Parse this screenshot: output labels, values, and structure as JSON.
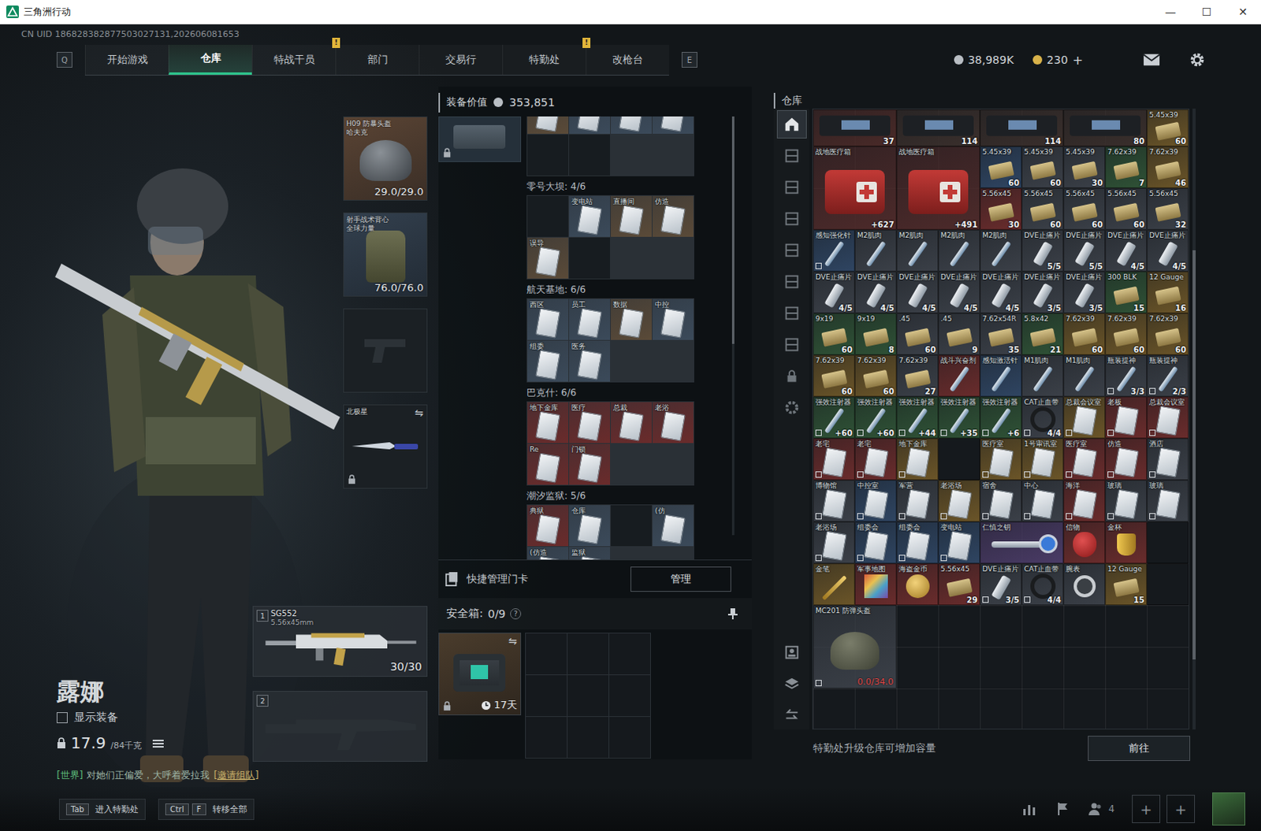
{
  "window": {
    "title": "三角洲行动",
    "controls": [
      "—",
      "☐",
      "✕"
    ]
  },
  "uid": "CN UID 186828382877503027131,202606081653",
  "nav": {
    "left_key": "Q",
    "right_key": "E",
    "tabs": [
      {
        "label": "开始游戏",
        "selected": false
      },
      {
        "label": "仓库",
        "selected": true
      },
      {
        "label": "特战干员",
        "selected": false,
        "badge": "!"
      },
      {
        "label": "部门",
        "selected": false
      },
      {
        "label": "交易行",
        "selected": false
      },
      {
        "label": "特勤处",
        "selected": false,
        "badge": "!"
      },
      {
        "label": "改枪台",
        "selected": false
      }
    ],
    "wallet": [
      {
        "value": "38,989K",
        "color": "#b9bec4"
      },
      {
        "value": "230",
        "plus": "+",
        "color": "#d8b24a"
      }
    ]
  },
  "operator": {
    "name": "露娜",
    "show_gear": {
      "label": "显示装备",
      "checked": false
    },
    "weight": "17.9",
    "capacity": "/84千克",
    "chat": {
      "channel": "[世界]",
      "text": "对她们正偏爱，大呼着爱拉我",
      "link": "[邀请组队]"
    }
  },
  "equipment": {
    "helmet": {
      "name": "H09 防暴头盔",
      "sub": "哈夫克",
      "durability": "29.0/29.0"
    },
    "armor": {
      "name": "射手战术背心",
      "sub": "全球力量",
      "durability": "76.0/76.0"
    },
    "pistol": {
      "empty": true
    },
    "melee": {
      "name": "北极星",
      "swap": "⇋",
      "locked": true
    }
  },
  "weapons": [
    {
      "slot": "1",
      "name": "SG552",
      "caliber": "5.56x45mm",
      "ammo": "30/30",
      "empty": false
    },
    {
      "slot": "2",
      "empty": true
    }
  ],
  "loadout": {
    "value_label": "装备价值",
    "value": "353,851",
    "keycase_locked": true,
    "sections": [
      {
        "cards": [
          {
            "kind": "card",
            "color": "#5a4a38"
          },
          {
            "kind": "card",
            "color": "#3b4a5a"
          },
          {
            "kind": "card",
            "color": "#3b4a5a"
          },
          {
            "kind": "card",
            "color": "#3b4a5a"
          },
          {
            "kind": "empty"
          },
          {
            "kind": "empty"
          }
        ]
      },
      {
        "title": "零号大坝: 4/6",
        "cards": [
          {
            "kind": "empty"
          },
          {
            "kind": "card",
            "label": "变电站",
            "color": "#3b4a5a"
          },
          {
            "kind": "card",
            "label": "直播间",
            "color": "#5a4a38"
          },
          {
            "kind": "card",
            "label": "仿造",
            "color": "#5a4a38"
          },
          {
            "kind": "card",
            "label": "误导",
            "color": "#5a4a38"
          },
          {
            "kind": "empty"
          }
        ]
      },
      {
        "title": "航天基地: 6/6",
        "cards": [
          {
            "kind": "card",
            "label": "西区",
            "color": "#3b4a5a"
          },
          {
            "kind": "card",
            "label": "员工",
            "color": "#3b4a5a"
          },
          {
            "kind": "card",
            "label": "数据",
            "color": "#5a4a38"
          },
          {
            "kind": "card",
            "label": "中控",
            "color": "#3b4a5a"
          },
          {
            "kind": "card",
            "label": "组委",
            "color": "#3b4a5a"
          },
          {
            "kind": "card",
            "label": "医务",
            "color": "#3b4a5a"
          }
        ]
      },
      {
        "title": "巴克什: 6/6",
        "cards": [
          {
            "kind": "card",
            "label": "地下金库",
            "color": "#6a2b2b"
          },
          {
            "kind": "card",
            "label": "医疗",
            "color": "#6a2b2b"
          },
          {
            "kind": "card",
            "label": "总裁",
            "color": "#6a2b2b"
          },
          {
            "kind": "card",
            "label": "老浴",
            "color": "#6a2b2b"
          },
          {
            "kind": "card",
            "label": "Re",
            "color": "#6a2b2b"
          },
          {
            "kind": "card",
            "label": "门锁",
            "color": "#6a2b2b"
          }
        ]
      },
      {
        "title": "潮汐监狱: 5/6",
        "cards": [
          {
            "kind": "card",
            "label": "典狱",
            "color": "#6a2b2b"
          },
          {
            "kind": "card",
            "label": "仓库",
            "color": "#3b4a5a"
          },
          {
            "kind": "empty"
          },
          {
            "kind": "card",
            "label": "(仿",
            "color": "#3b4a5a"
          },
          {
            "kind": "card",
            "label": "(仿造",
            "color": "#3b4a5a"
          },
          {
            "kind": "card",
            "label": "监狱",
            "color": "#3b4a5a"
          }
        ]
      }
    ],
    "quick_label": "快捷管理门卡",
    "manage": "管理",
    "safe": {
      "label": "安全箱:",
      "count": "0/9",
      "help": "?",
      "days": "17天",
      "swap": "⇋",
      "locked": true
    }
  },
  "warehouse": {
    "title": "仓库",
    "side_tabs": [
      {
        "kind": "home",
        "selected": true
      },
      {
        "kind": "shelf",
        "selected": false
      },
      {
        "kind": "shelf",
        "selected": false
      },
      {
        "kind": "shelf",
        "selected": false
      },
      {
        "kind": "shelf",
        "selected": false
      },
      {
        "kind": "shelf",
        "selected": false
      },
      {
        "kind": "shelf",
        "selected": false
      },
      {
        "kind": "shelf",
        "selected": false
      },
      {
        "kind": "lock",
        "selected": false
      },
      {
        "kind": "gear",
        "selected": false
      }
    ],
    "tools": [
      {
        "kind": "person"
      },
      {
        "kind": "layers"
      },
      {
        "kind": "transfer"
      }
    ],
    "items": [
      {
        "kind": "case",
        "count": "37",
        "color": "#4a2a28",
        "bound": false
      },
      {
        "kind": "case",
        "count": "114",
        "color": "#3a2f2c",
        "bound": false
      },
      {
        "kind": "case",
        "count": "114",
        "color": "#3a2f2c",
        "bound": false
      },
      {
        "kind": "case",
        "count": "80",
        "color": "#3a2f2c",
        "bound": false
      },
      {
        "kind": "ammo",
        "name": "5.45x39",
        "count": "60",
        "color": "#6b5528",
        "bound": false
      },
      {
        "kind": "medkit",
        "name": "战地医疗箱",
        "count": "+627",
        "color": "#4d2a2a",
        "bound": false
      },
      {
        "kind": "medkit",
        "name": "战地医疗箱",
        "count": "+491",
        "color": "#4d2a2a",
        "bound": false
      },
      {
        "kind": "ammo",
        "name": "5.45x39",
        "count": "60",
        "color": "#2f4562",
        "bound": false
      },
      {
        "kind": "ammo",
        "name": "5.45x39",
        "count": "60",
        "color": "#3b4048",
        "bound": false
      },
      {
        "kind": "ammo",
        "name": "5.45x39",
        "count": "30",
        "color": "#3b4048",
        "bound": false
      },
      {
        "kind": "ammo",
        "name": "7.62x39",
        "count": "7",
        "color": "#2f5236",
        "bound": false
      },
      {
        "kind": "ammo",
        "name": "7.62x39",
        "count": "46",
        "color": "#6b5528",
        "bound": false
      },
      {
        "kind": "ammo",
        "name": "5.56x45",
        "count": "30",
        "color": "#6a2c2c",
        "bound": false
      },
      {
        "kind": "ammo",
        "name": "5.56x45",
        "count": "60",
        "color": "#3b4048",
        "bound": false
      },
      {
        "kind": "ammo",
        "name": "5.56x45",
        "count": "60",
        "color": "#3b4048",
        "bound": false
      },
      {
        "kind": "ammo",
        "name": "5.56x45",
        "count": "60",
        "color": "#3b4048",
        "bound": false
      },
      {
        "kind": "ammo",
        "name": "5.56x45",
        "count": "32",
        "color": "#3b4048",
        "bound": false
      },
      {
        "kind": "syringe",
        "name": "感知强化针",
        "color": "#2f4562",
        "bound": true
      },
      {
        "kind": "syringe",
        "name": "M2肌肉",
        "color": "#3b4048",
        "bound": false
      },
      {
        "kind": "syringe",
        "name": "M2肌肉",
        "color": "#3b4048",
        "bound": false
      },
      {
        "kind": "syringe",
        "name": "M2肌肉",
        "color": "#3b4048",
        "bound": false
      },
      {
        "kind": "syringe",
        "name": "M2肌肉",
        "color": "#3b4048",
        "bound": false
      },
      {
        "kind": "pills",
        "name": "DVE止痛片",
        "count": "5/5",
        "color": "#3b4048",
        "bound": false
      },
      {
        "kind": "pills",
        "name": "DVE止痛片",
        "count": "5/5",
        "color": "#3b4048",
        "bound": false
      },
      {
        "kind": "pills",
        "name": "DVE止痛片",
        "count": "4/5",
        "color": "#3b4048",
        "bound": false
      },
      {
        "kind": "pills",
        "name": "DVE止痛片",
        "count": "4/5",
        "color": "#3b4048",
        "bound": false
      },
      {
        "kind": "pills",
        "name": "DVE止痛片",
        "count": "4/5",
        "color": "#3b4048",
        "bound": false
      },
      {
        "kind": "pills",
        "name": "DVE止痛片",
        "count": "4/5",
        "color": "#3b4048",
        "bound": false
      },
      {
        "kind": "pills",
        "name": "DVE止痛片",
        "count": "4/5",
        "color": "#3b4048",
        "bound": false
      },
      {
        "kind": "pills",
        "name": "DVE止痛片",
        "count": "4/5",
        "color": "#3b4048",
        "bound": false
      },
      {
        "kind": "pills",
        "name": "DVE止痛片",
        "count": "4/5",
        "color": "#3b4048",
        "bound": false
      },
      {
        "kind": "pills",
        "name": "DVE止痛片",
        "count": "3/5",
        "color": "#3b4048",
        "bound": false
      },
      {
        "kind": "pills",
        "name": "DVE止痛片",
        "count": "3/5",
        "color": "#3b4048",
        "bound": false
      },
      {
        "kind": "ammo",
        "name": "300 BLK",
        "count": "15",
        "color": "#2f5236",
        "bound": false
      },
      {
        "kind": "ammo",
        "name": "12 Gauge",
        "count": "16",
        "color": "#6b5528",
        "bound": false
      },
      {
        "kind": "ammo",
        "name": "9x19",
        "count": "60",
        "color": "#2f5236",
        "bound": false
      },
      {
        "kind": "ammo",
        "name": "9x19",
        "count": "8",
        "color": "#2f5236",
        "bound": false
      },
      {
        "kind": "ammo",
        "name": ".45",
        "count": "60",
        "color": "#3b4048",
        "bound": false
      },
      {
        "kind": "ammo",
        "name": ".45",
        "count": "9",
        "color": "#3b4048",
        "bound": false
      },
      {
        "kind": "ammo",
        "name": "7.62x54R",
        "count": "35",
        "color": "#3b4048",
        "bound": false
      },
      {
        "kind": "ammo",
        "name": "5.8x42",
        "count": "21",
        "color": "#2f5236",
        "bound": false
      },
      {
        "kind": "ammo",
        "name": "7.62x39",
        "count": "60",
        "color": "#6b5528",
        "bound": false
      },
      {
        "kind": "ammo",
        "name": "7.62x39",
        "count": "60",
        "color": "#6b5528",
        "bound": false
      },
      {
        "kind": "ammo",
        "name": "7.62x39",
        "count": "60",
        "color": "#6b5528",
        "bound": false
      },
      {
        "kind": "ammo",
        "name": "7.62x39",
        "count": "60",
        "color": "#6b5528",
        "bound": false
      },
      {
        "kind": "ammo",
        "name": "7.62x39",
        "count": "60",
        "color": "#6b5528",
        "bound": false
      },
      {
        "kind": "ammo",
        "name": "7.62x39",
        "count": "27",
        "color": "#3b4048",
        "bound": false
      },
      {
        "kind": "syringe",
        "name": "战斗兴奋剂",
        "color": "#6a2c2c",
        "bound": false
      },
      {
        "kind": "syringe",
        "name": "感知激活针",
        "color": "#2f4562",
        "bound": false
      },
      {
        "kind": "syringe",
        "name": "M1肌肉",
        "color": "#3b4048",
        "bound": false
      },
      {
        "kind": "syringe",
        "name": "M1肌肉",
        "color": "#3b4048",
        "bound": false
      },
      {
        "kind": "syringe",
        "name": "瓶装提神",
        "count": "3/3",
        "color": "#3b4048",
        "bound": true
      },
      {
        "kind": "syringe",
        "name": "瓶装提神",
        "count": "2/3",
        "color": "#3b4048",
        "bound": true
      },
      {
        "kind": "syringe",
        "name": "强效注射器",
        "count": "+60",
        "color": "#2f5236",
        "bound": true
      },
      {
        "kind": "syringe",
        "name": "强效注射器",
        "count": "+60",
        "color": "#2f5236",
        "bound": true
      },
      {
        "kind": "syringe",
        "name": "强效注射器",
        "count": "+44",
        "color": "#2f5236",
        "bound": true
      },
      {
        "kind": "syringe",
        "name": "强效注射器",
        "count": "+35",
        "color": "#2f5236",
        "bound": true
      },
      {
        "kind": "syringe",
        "name": "强效注射器",
        "count": "+6",
        "color": "#2f5236",
        "bound": true
      },
      {
        "kind": "band",
        "name": "CAT止血带",
        "count": "4/4",
        "color": "#3b4048",
        "bound": true
      },
      {
        "kind": "card",
        "name": "总裁会议室",
        "color": "#6b5528",
        "bound": true
      },
      {
        "kind": "card",
        "name": "老板",
        "color": "#6a2c2c",
        "bound": true
      },
      {
        "kind": "card",
        "name": "总裁会议室",
        "color": "#6a2c2c",
        "bound": true
      },
      {
        "kind": "card",
        "name": "老宅",
        "color": "#6a2c2c",
        "bound": true
      },
      {
        "kind": "card",
        "name": "老宅",
        "color": "#6a2c2c",
        "bound": true
      },
      {
        "kind": "card",
        "name": "地下金库",
        "color": "#6b5528",
        "bound": true
      },
      {
        "kind": "empty"
      },
      {
        "kind": "card",
        "name": "医疗室",
        "color": "#6b5528",
        "bound": true
      },
      {
        "kind": "card",
        "name": "1号审讯室",
        "color": "#6b5528",
        "bound": true
      },
      {
        "kind": "card",
        "name": "医疗室",
        "color": "#6a2c2c",
        "bound": true
      },
      {
        "kind": "card",
        "name": "仿造",
        "color": "#6a2c2c",
        "bound": true
      },
      {
        "kind": "card",
        "name": "酒店",
        "color": "#3b4048",
        "bound": true
      },
      {
        "kind": "card",
        "name": "博物馆",
        "color": "#3b4048",
        "bound": true
      },
      {
        "kind": "card",
        "name": "中控室",
        "color": "#2f4562",
        "bound": true
      },
      {
        "kind": "card",
        "name": "军营",
        "color": "#3b4048",
        "bound": true
      },
      {
        "kind": "card",
        "name": "老浴场",
        "color": "#6b5528",
        "bound": true
      },
      {
        "kind": "card",
        "name": "宿舍",
        "color": "#3b4048",
        "bound": true
      },
      {
        "kind": "card",
        "name": "中心",
        "color": "#3b4048",
        "bound": true
      },
      {
        "kind": "card",
        "name": "海洋",
        "color": "#6a2c2c",
        "bound": true
      },
      {
        "kind": "card",
        "name": "玻璃",
        "color": "#3b4048",
        "bound": true
      },
      {
        "kind": "card",
        "name": "玻璃",
        "color": "#3b4048",
        "bound": true
      },
      {
        "kind": "card",
        "name": "老浴场",
        "color": "#3b4048",
        "bound": true
      },
      {
        "kind": "card",
        "name": "组委会",
        "color": "#2f4562",
        "bound": true
      },
      {
        "kind": "card",
        "name": "组委会",
        "color": "#2f4562",
        "bound": true
      },
      {
        "kind": "card",
        "name": "变电站",
        "color": "#2f4562",
        "bound": true
      },
      {
        "kind": "key",
        "name": "仁慎之钥",
        "color": "#4a3b66",
        "bound": false
      },
      {
        "kind": "mask",
        "name": "信物",
        "color": "#6a2c2c",
        "bound": false
      },
      {
        "kind": "cup",
        "name": "金杯",
        "color": "#6a2c2c",
        "bound": false
      },
      {
        "kind": "empty"
      },
      {
        "kind": "pen",
        "name": "金笔",
        "color": "#6b5528",
        "bound": false
      },
      {
        "kind": "map",
        "name": "军事地图",
        "color": "#6a2c2c",
        "bound": false
      },
      {
        "kind": "coin",
        "name": "海盗金币",
        "color": "#6a2c2c",
        "bound": false
      },
      {
        "kind": "ammo",
        "name": "5.56x45",
        "count": "29",
        "color": "#6a2c2c",
        "bound": false
      },
      {
        "kind": "pills",
        "name": "DVE止痛片",
        "count": "3/5",
        "color": "#3b4048",
        "bound": true
      },
      {
        "kind": "band",
        "name": "CAT止血带",
        "count": "4/4",
        "color": "#3b4048",
        "bound": true
      },
      {
        "kind": "watch",
        "name": "腕表",
        "color": "#3b4048",
        "bound": false
      },
      {
        "kind": "ammo",
        "name": "12 Gauge",
        "count": "15",
        "color": "#6b5528",
        "bound": false
      },
      {
        "kind": "empty"
      },
      {
        "kind": "helmet",
        "name": "MC201 防弹头盔",
        "durability": "0.0/34.0",
        "broken": true,
        "color": "#3b4048",
        "bound": true
      }
    ],
    "footer": "特勤处升级仓库可增加容量",
    "go": "前往"
  },
  "bottom": {
    "hints": [
      {
        "keys": [
          "Tab"
        ],
        "label": "进入特勤处"
      },
      {
        "keys": [
          "Ctrl",
          "F"
        ],
        "label": "转移全部"
      }
    ],
    "friends": "4",
    "slots": [
      "+",
      "+"
    ]
  }
}
